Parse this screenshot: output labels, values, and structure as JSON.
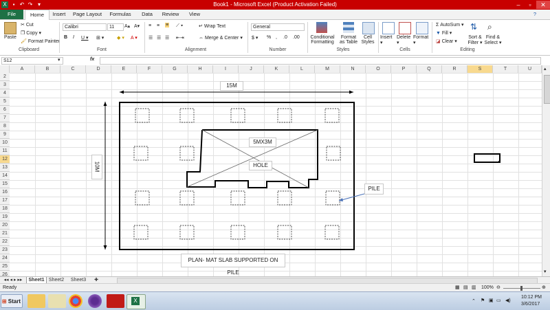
{
  "window": {
    "title": "Book1 - Microsoft Excel (Product Activation Failed)",
    "title_color": "#c80000"
  },
  "tabs": [
    "File",
    "Home",
    "Insert",
    "Page Layout",
    "Formulas",
    "Data",
    "Review",
    "View"
  ],
  "ribbon": {
    "clipboard": {
      "paste": "Paste",
      "cut": "Cut",
      "copy": "Copy",
      "format_painter": "Format Painter",
      "label": "Clipboard"
    },
    "font": {
      "name": "Calibri",
      "size": "11",
      "label": "Font"
    },
    "alignment": {
      "wrap": "Wrap Text",
      "merge": "Merge & Center",
      "label": "Alignment"
    },
    "number": {
      "format": "General",
      "label": "Number"
    },
    "styles": {
      "conditional": "Conditional",
      "formatting": "Formatting",
      "format_as": "Format",
      "as_table": "as Table",
      "cell": "Cell",
      "cell_styles": "Styles",
      "label": "Styles"
    },
    "cells": {
      "insert": "Insert",
      "delete": "Delete",
      "format": "Format",
      "label": "Cells"
    },
    "editing": {
      "autosum": "AutoSum",
      "fill": "Fill",
      "clear": "Clear",
      "sort": "Sort &",
      "filter": "Filter",
      "find": "Find &",
      "select": "Select",
      "label": "Editing"
    }
  },
  "formula_bar": {
    "name_box": "S12",
    "fx": "fx",
    "value": ""
  },
  "columns": [
    "A",
    "B",
    "C",
    "D",
    "E",
    "F",
    "G",
    "H",
    "I",
    "J",
    "K",
    "L",
    "M",
    "N",
    "O",
    "P",
    "Q",
    "R",
    "S",
    "T",
    "U"
  ],
  "rows": [
    "2",
    "3",
    "4",
    "5",
    "6",
    "7",
    "8",
    "9",
    "10",
    "11",
    "12",
    "13",
    "14",
    "15",
    "16",
    "17",
    "18",
    "19",
    "20",
    "21",
    "22",
    "23",
    "24",
    "25",
    "26"
  ],
  "drawing": {
    "dim_width": "15M",
    "dim_height": "10M",
    "hole_size": "5MX3M",
    "hole_label": "HOLE",
    "pile_label": "PILE",
    "caption": "PLAN- MAT SLAB SUPPORTED ON PILE"
  },
  "sheets": [
    "Sheet1",
    "Sheet2",
    "Sheet3"
  ],
  "status": {
    "ready": "Ready",
    "zoom": "100%"
  },
  "taskbar": {
    "start": "Start",
    "time": "10:12 PM",
    "date": "3/6/2017"
  }
}
